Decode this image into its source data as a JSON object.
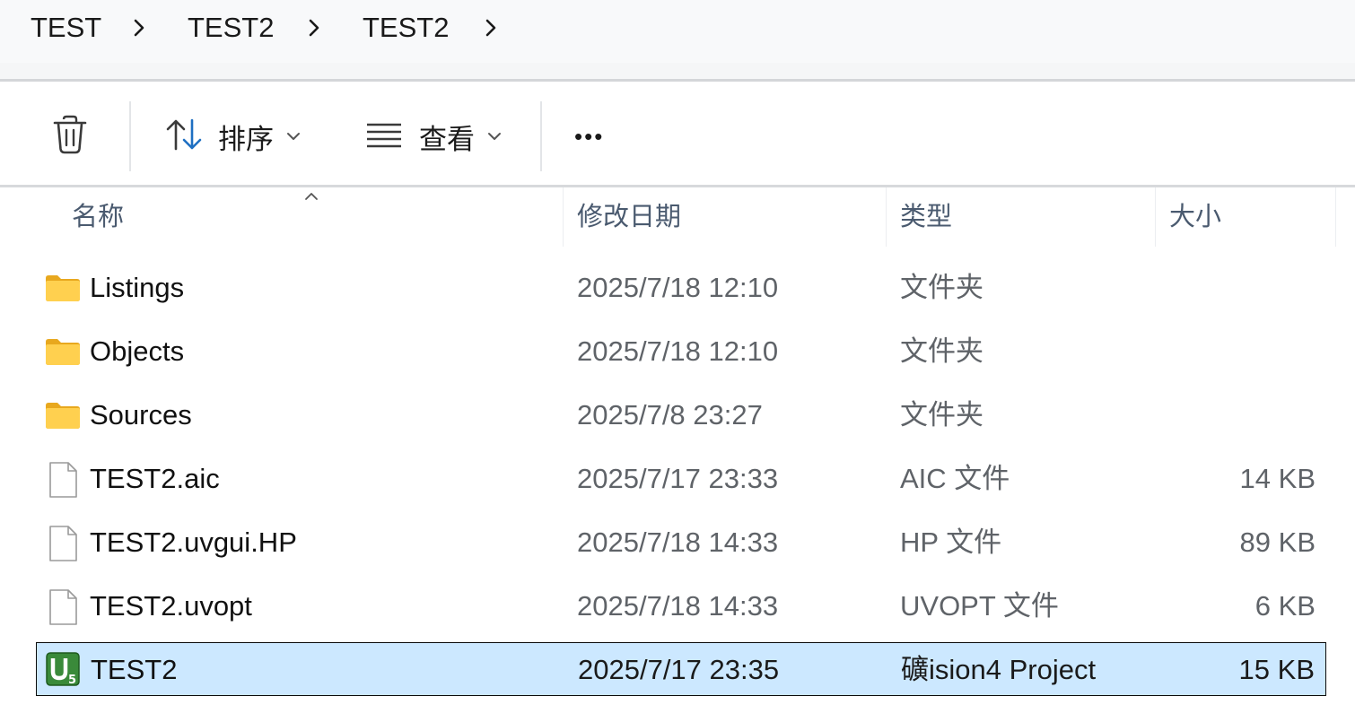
{
  "breadcrumb": {
    "items": [
      "TEST",
      "TEST2",
      "TEST2"
    ]
  },
  "toolbar": {
    "delete_icon": "trash-icon",
    "sort_label": "排序",
    "view_label": "查看",
    "more_label": "•••"
  },
  "columns": {
    "name": "名称",
    "date": "修改日期",
    "type": "类型",
    "size": "大小",
    "sort": "ascending"
  },
  "files": [
    {
      "name": "Listings",
      "date": "2025/7/18 12:10",
      "type": "文件夹",
      "size": "",
      "icon": "folder-icon",
      "selected": false
    },
    {
      "name": "Objects",
      "date": "2025/7/18 12:10",
      "type": "文件夹",
      "size": "",
      "icon": "folder-icon",
      "selected": false
    },
    {
      "name": "Sources",
      "date": "2025/7/8 23:27",
      "type": "文件夹",
      "size": "",
      "icon": "folder-icon",
      "selected": false
    },
    {
      "name": "TEST2.aic",
      "date": "2025/7/17 23:33",
      "type": "AIC 文件",
      "size": "14 KB",
      "icon": "file-icon",
      "selected": false
    },
    {
      "name": "TEST2.uvgui.HP",
      "date": "2025/7/18 14:33",
      "type": "HP 文件",
      "size": "89 KB",
      "icon": "file-icon",
      "selected": false
    },
    {
      "name": "TEST2.uvopt",
      "date": "2025/7/18 14:33",
      "type": "UVOPT 文件",
      "size": "6 KB",
      "icon": "file-icon",
      "selected": false
    },
    {
      "name": "TEST2",
      "date": "2025/7/17 23:35",
      "type": "礦ision4 Project",
      "size": "15 KB",
      "icon": "uvision-project-icon",
      "selected": true
    }
  ],
  "colors": {
    "selection_bg": "#cce8ff",
    "header_text": "#4a5a6f",
    "folder_yellow": "#ffd04f",
    "uvision_green": "#3a8a3a"
  }
}
